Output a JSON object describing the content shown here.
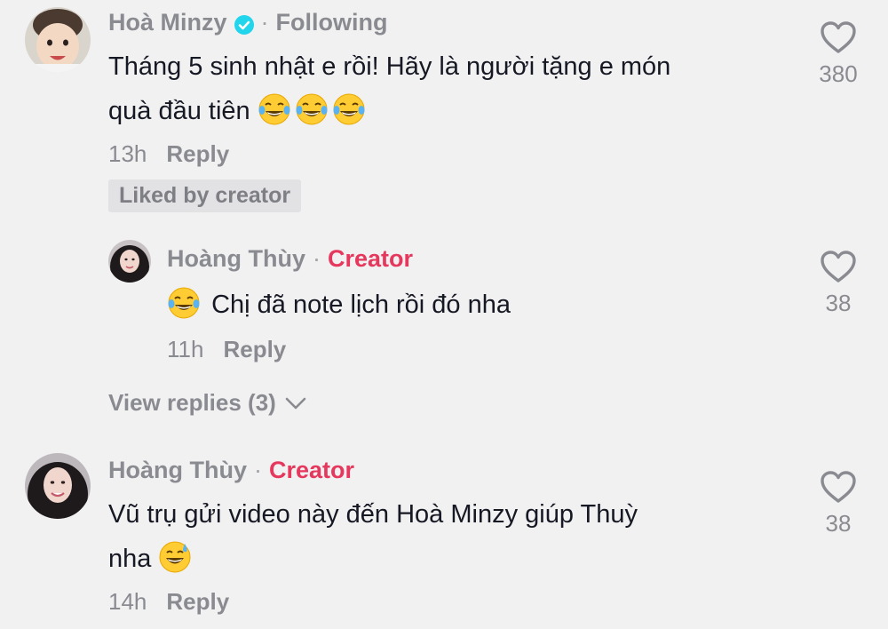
{
  "comments": [
    {
      "author": "Hoà Minzy",
      "verified": true,
      "tag": "Following",
      "text_line1": "Tháng 5 sinh nhật e rồi! Hãy là người tặng e món",
      "text_line2": "quà đầu tiên",
      "emojis": [
        "tears-of-joy",
        "tears-of-joy",
        "tears-of-joy"
      ],
      "time": "13h",
      "reply_label": "Reply",
      "badge": "Liked by creator",
      "likes": "380",
      "reply": {
        "author": "Hoàng Thùy",
        "tag": "Creator",
        "leading_emoji": "tears-of-joy",
        "text": "Chị đã note lịch rồi đó nha",
        "time": "11h",
        "reply_label": "Reply",
        "likes": "38"
      },
      "view_replies": "View replies (3)"
    },
    {
      "author": "Hoàng Thùy",
      "tag": "Creator",
      "text_line1": "Vũ trụ gửi video này đến Hoà Minzy giúp Thuỳ",
      "text_line2": "nha",
      "emojis": [
        "grinning-sweat"
      ],
      "time": "14h",
      "reply_label": "Reply",
      "likes": "38"
    }
  ],
  "colors": {
    "background": "#f1f1f2",
    "text": "#161823",
    "muted": "#8a8b91",
    "creator": "#e6375d",
    "verified": "#20d5ec"
  }
}
